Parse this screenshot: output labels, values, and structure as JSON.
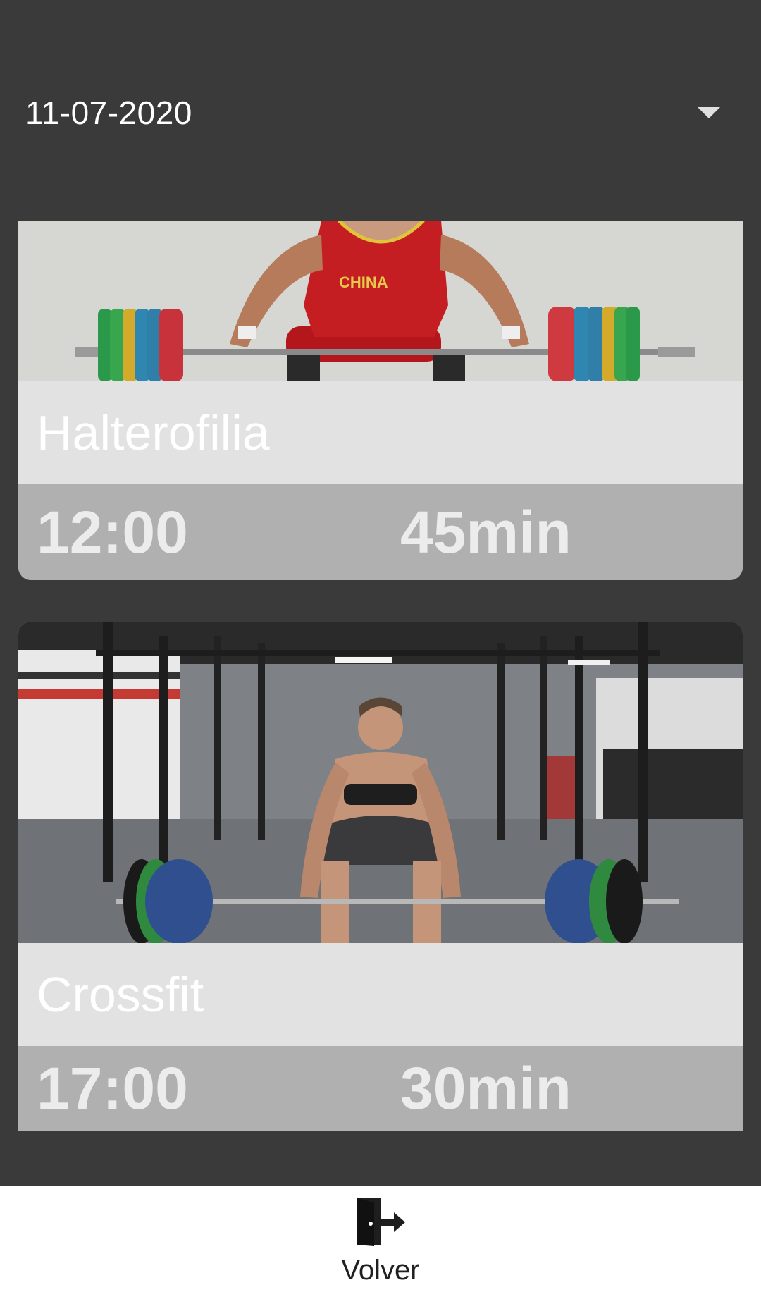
{
  "date_selector": {
    "value": "11-07-2020",
    "icon": "dropdown-caret-icon"
  },
  "classes": [
    {
      "name": "Halterofilia",
      "time": "12:00",
      "duration": "45min",
      "image": "weightlifter-photo",
      "shirt_text": "CHINA"
    },
    {
      "name": "Crossfit",
      "time": "17:00",
      "duration": "30min",
      "image": "crossfit-athlete-photo"
    }
  ],
  "bottom_nav": {
    "back_label": "Volver",
    "back_icon": "exit-door-icon"
  },
  "colors": {
    "background": "#3a3a3a",
    "name_band": "#e2e2e2",
    "info_band": "#b0b0b0",
    "bottom_bar": "#ffffff"
  }
}
